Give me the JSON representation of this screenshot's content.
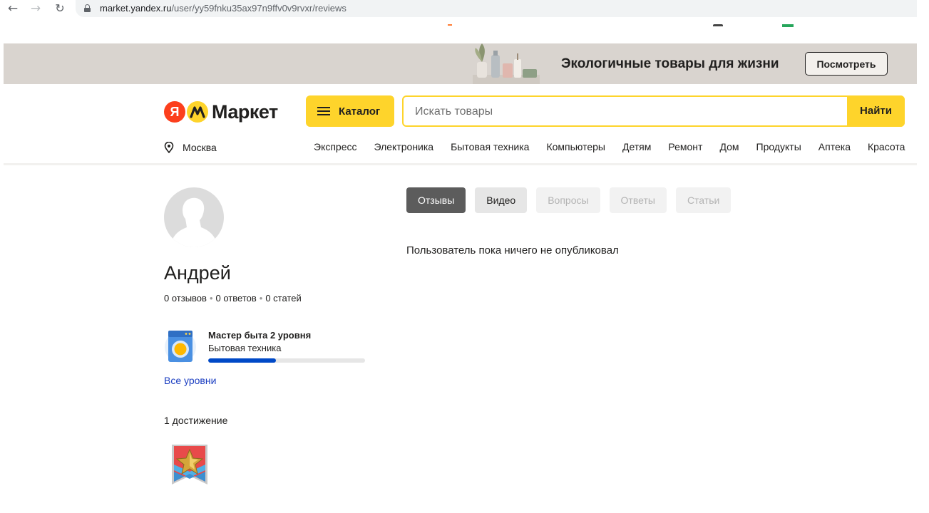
{
  "browser": {
    "url_host": "market.yandex.ru",
    "url_path": "/user/yy59fnku35ax97n9ffv0v9rvxr/reviews"
  },
  "banner": {
    "text": "Экологичные товары для жизни",
    "button_label": "Посмотреть"
  },
  "header": {
    "logo_ya": "Я",
    "logo_text": "Маркет",
    "catalog_label": "Каталог",
    "search_placeholder": "Искать товары",
    "search_button": "Найти",
    "region": "Москва",
    "categories": [
      "Экспресс",
      "Электроника",
      "Бытовая техника",
      "Компьютеры",
      "Детям",
      "Ремонт",
      "Дом",
      "Продукты",
      "Аптека",
      "Красота"
    ]
  },
  "profile": {
    "name": "Андрей",
    "stats": [
      "0 отзывов",
      "0 ответов",
      "0 статей"
    ],
    "level": {
      "title": "Мастер быта 2 уровня",
      "category": "Бытовая техника",
      "progress": 0.43
    },
    "all_levels_link": "Все уровни",
    "achievements_title": "1 достижение"
  },
  "tabs": [
    {
      "label": "Отзывы",
      "state": "active"
    },
    {
      "label": "Видео",
      "state": "normal"
    },
    {
      "label": "Вопросы",
      "state": "disabled"
    },
    {
      "label": "Ответы",
      "state": "disabled"
    },
    {
      "label": "Статьи",
      "state": "disabled"
    }
  ],
  "content": {
    "empty_message": "Пользователь пока ничего не опубликовал"
  },
  "colors": {
    "accent_yellow": "#fed42b",
    "brand_red": "#fc3f1d",
    "link_blue": "#1a3dc1",
    "progress_blue": "#0049c7"
  }
}
